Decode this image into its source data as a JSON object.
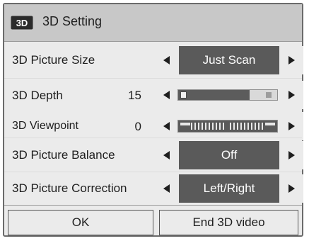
{
  "header": {
    "icon": "3d-icon",
    "icon_text": "3D",
    "title": "3D Setting"
  },
  "rows": {
    "picture_size": {
      "label": "3D Picture Size",
      "value": "Just Scan"
    },
    "depth": {
      "label": "3D Depth",
      "value": "15",
      "level_fraction": 0.05
    },
    "viewpoint": {
      "label": "3D Viewpoint",
      "value": "0"
    },
    "balance": {
      "label": "3D Picture Balance",
      "value": "Off"
    },
    "correction": {
      "label": "3D Picture Correction",
      "value": "Left/Right"
    }
  },
  "buttons": {
    "ok": "OK",
    "end": "End 3D video"
  }
}
